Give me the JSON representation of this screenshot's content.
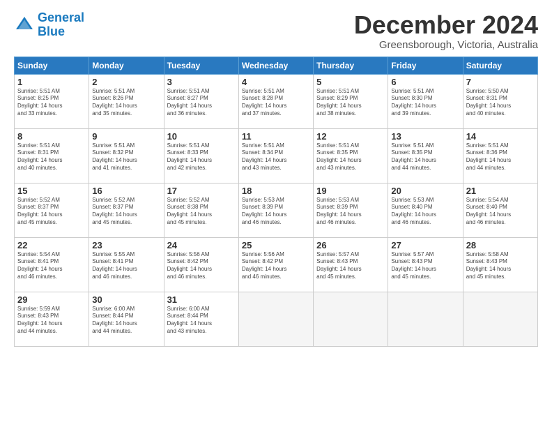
{
  "logo": {
    "line1": "General",
    "line2": "Blue"
  },
  "title": "December 2024",
  "subtitle": "Greensborough, Victoria, Australia",
  "days_of_week": [
    "Sunday",
    "Monday",
    "Tuesday",
    "Wednesday",
    "Thursday",
    "Friday",
    "Saturday"
  ],
  "weeks": [
    [
      {
        "num": "1",
        "info": "Sunrise: 5:51 AM\nSunset: 8:25 PM\nDaylight: 14 hours\nand 33 minutes."
      },
      {
        "num": "2",
        "info": "Sunrise: 5:51 AM\nSunset: 8:26 PM\nDaylight: 14 hours\nand 35 minutes."
      },
      {
        "num": "3",
        "info": "Sunrise: 5:51 AM\nSunset: 8:27 PM\nDaylight: 14 hours\nand 36 minutes."
      },
      {
        "num": "4",
        "info": "Sunrise: 5:51 AM\nSunset: 8:28 PM\nDaylight: 14 hours\nand 37 minutes."
      },
      {
        "num": "5",
        "info": "Sunrise: 5:51 AM\nSunset: 8:29 PM\nDaylight: 14 hours\nand 38 minutes."
      },
      {
        "num": "6",
        "info": "Sunrise: 5:51 AM\nSunset: 8:30 PM\nDaylight: 14 hours\nand 39 minutes."
      },
      {
        "num": "7",
        "info": "Sunrise: 5:50 AM\nSunset: 8:31 PM\nDaylight: 14 hours\nand 40 minutes."
      }
    ],
    [
      {
        "num": "8",
        "info": "Sunrise: 5:51 AM\nSunset: 8:31 PM\nDaylight: 14 hours\nand 40 minutes."
      },
      {
        "num": "9",
        "info": "Sunrise: 5:51 AM\nSunset: 8:32 PM\nDaylight: 14 hours\nand 41 minutes."
      },
      {
        "num": "10",
        "info": "Sunrise: 5:51 AM\nSunset: 8:33 PM\nDaylight: 14 hours\nand 42 minutes."
      },
      {
        "num": "11",
        "info": "Sunrise: 5:51 AM\nSunset: 8:34 PM\nDaylight: 14 hours\nand 43 minutes."
      },
      {
        "num": "12",
        "info": "Sunrise: 5:51 AM\nSunset: 8:35 PM\nDaylight: 14 hours\nand 43 minutes."
      },
      {
        "num": "13",
        "info": "Sunrise: 5:51 AM\nSunset: 8:35 PM\nDaylight: 14 hours\nand 44 minutes."
      },
      {
        "num": "14",
        "info": "Sunrise: 5:51 AM\nSunset: 8:36 PM\nDaylight: 14 hours\nand 44 minutes."
      }
    ],
    [
      {
        "num": "15",
        "info": "Sunrise: 5:52 AM\nSunset: 8:37 PM\nDaylight: 14 hours\nand 45 minutes."
      },
      {
        "num": "16",
        "info": "Sunrise: 5:52 AM\nSunset: 8:37 PM\nDaylight: 14 hours\nand 45 minutes."
      },
      {
        "num": "17",
        "info": "Sunrise: 5:52 AM\nSunset: 8:38 PM\nDaylight: 14 hours\nand 45 minutes."
      },
      {
        "num": "18",
        "info": "Sunrise: 5:53 AM\nSunset: 8:39 PM\nDaylight: 14 hours\nand 46 minutes."
      },
      {
        "num": "19",
        "info": "Sunrise: 5:53 AM\nSunset: 8:39 PM\nDaylight: 14 hours\nand 46 minutes."
      },
      {
        "num": "20",
        "info": "Sunrise: 5:53 AM\nSunset: 8:40 PM\nDaylight: 14 hours\nand 46 minutes."
      },
      {
        "num": "21",
        "info": "Sunrise: 5:54 AM\nSunset: 8:40 PM\nDaylight: 14 hours\nand 46 minutes."
      }
    ],
    [
      {
        "num": "22",
        "info": "Sunrise: 5:54 AM\nSunset: 8:41 PM\nDaylight: 14 hours\nand 46 minutes."
      },
      {
        "num": "23",
        "info": "Sunrise: 5:55 AM\nSunset: 8:41 PM\nDaylight: 14 hours\nand 46 minutes."
      },
      {
        "num": "24",
        "info": "Sunrise: 5:56 AM\nSunset: 8:42 PM\nDaylight: 14 hours\nand 46 minutes."
      },
      {
        "num": "25",
        "info": "Sunrise: 5:56 AM\nSunset: 8:42 PM\nDaylight: 14 hours\nand 46 minutes."
      },
      {
        "num": "26",
        "info": "Sunrise: 5:57 AM\nSunset: 8:43 PM\nDaylight: 14 hours\nand 45 minutes."
      },
      {
        "num": "27",
        "info": "Sunrise: 5:57 AM\nSunset: 8:43 PM\nDaylight: 14 hours\nand 45 minutes."
      },
      {
        "num": "28",
        "info": "Sunrise: 5:58 AM\nSunset: 8:43 PM\nDaylight: 14 hours\nand 45 minutes."
      }
    ],
    [
      {
        "num": "29",
        "info": "Sunrise: 5:59 AM\nSunset: 8:43 PM\nDaylight: 14 hours\nand 44 minutes."
      },
      {
        "num": "30",
        "info": "Sunrise: 6:00 AM\nSunset: 8:44 PM\nDaylight: 14 hours\nand 44 minutes."
      },
      {
        "num": "31",
        "info": "Sunrise: 6:00 AM\nSunset: 8:44 PM\nDaylight: 14 hours\nand 43 minutes."
      },
      {
        "num": "",
        "info": ""
      },
      {
        "num": "",
        "info": ""
      },
      {
        "num": "",
        "info": ""
      },
      {
        "num": "",
        "info": ""
      }
    ]
  ]
}
